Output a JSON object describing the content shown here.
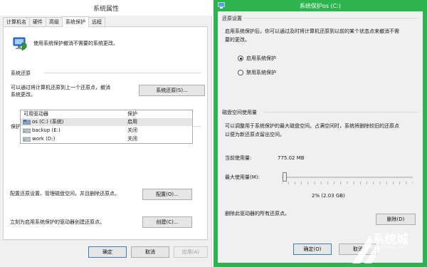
{
  "left_window": {
    "title": "系统属性",
    "tabs": [
      "计算机名",
      "硬件",
      "高级",
      "系统保护",
      "远程"
    ],
    "intro": "使用系统保护撤消不需要的系统更改。",
    "restore_section": {
      "heading": "系统还原",
      "description_line1": "可以通过将计算机还原到上一个还原点，撤消",
      "description_line2": "系统更改。",
      "button": "系统还原(S)..."
    },
    "protection_section": {
      "heading": "保护设置",
      "columns": [
        "可用驱动器",
        "保护"
      ],
      "drives": [
        {
          "name": "os (C:) (系统)",
          "state": "启用"
        },
        {
          "name": "backup (E:)",
          "state": "关闭"
        },
        {
          "name": "work (D:)",
          "state": "关闭"
        }
      ],
      "configure_text": "配置还原设置、管理磁盘空间，并且删除还原点。",
      "configure_button": "配置(O)...",
      "create_text": "立刻为启用系统保护的驱动器创建还原点。",
      "create_button": "创建(C)..."
    },
    "footer": {
      "ok": "确定",
      "cancel": "取消",
      "apply": "应用(A)"
    }
  },
  "right_window": {
    "title": "系统保护os (C:)",
    "accent_color": "#2db450",
    "restore_settings": {
      "heading": "还原设置",
      "description_line1": "启用系统保护后，你可以通过及时将计算机还原到以前的某个状态点来撤消不需",
      "description_line2": "要的更改。",
      "options": [
        "启用系统保护",
        "禁用系统保护"
      ],
      "selected_index": 0
    },
    "disk_usage": {
      "heading": "磁盘空间使用量",
      "description_line1": "可以调整用于系统保护的最大磁盘空间。占满空间时，系统将删除较旧的还原点",
      "description_line2": "以便为新还原点留出空间。",
      "current_label": "当前使用量:",
      "current_value": "775.02 MB",
      "max_label": "最大使用量(M):",
      "slider_percent": 2,
      "max_value": "2% (2.03 GB)"
    },
    "delete_text": "删除此驱动器的所有还原点。",
    "delete_button": "删除(D)",
    "footer": {
      "ok": "确定(O)",
      "cancel": "取消"
    }
  },
  "watermark": {
    "brand": "系统城",
    "url": "xitongcheng.com"
  }
}
